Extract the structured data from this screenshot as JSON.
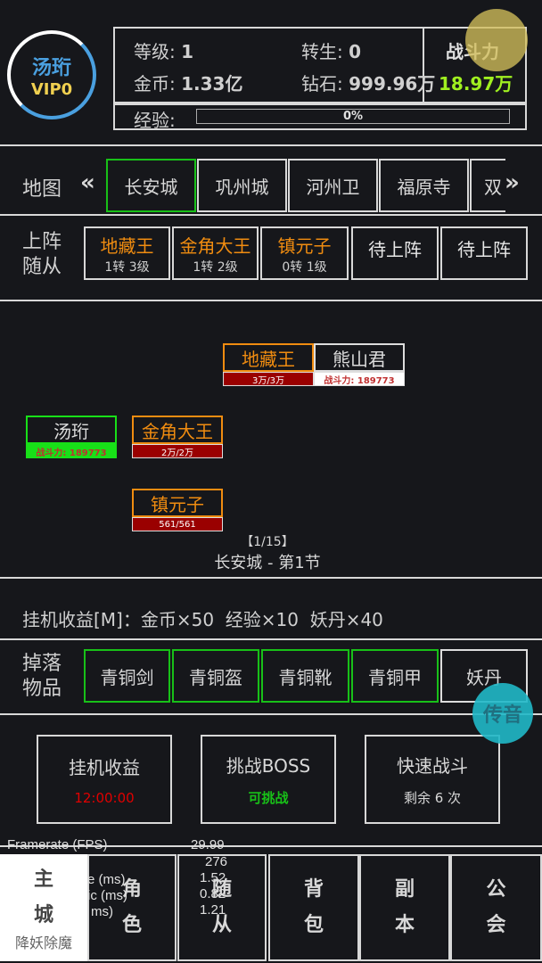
{
  "player": {
    "name": "汤珩",
    "vip": "VIP0"
  },
  "stats": {
    "level_label": "等级:",
    "level": "1",
    "rebirth_label": "转生:",
    "rebirth": "0",
    "gold_label": "金币:",
    "gold": "1.33亿",
    "diamond_label": "钻石:",
    "diamond": "999.96万",
    "power_label": "战斗力",
    "power": "18.97万",
    "exp_label": "经验:",
    "exp_text": "0%",
    "exp_progress": 0
  },
  "map": {
    "label": "地图",
    "prev": "«",
    "next": "»",
    "tabs": [
      "长安城",
      "巩州城",
      "河州卫",
      "福原寺",
      "双"
    ],
    "selected": "长安城"
  },
  "followers": {
    "label_line1": "上阵",
    "label_line2": "随从",
    "slots": [
      {
        "name": "地藏王",
        "info": "1转 3级"
      },
      {
        "name": "金角大王",
        "info": "1转 2级"
      },
      {
        "name": "镇元子",
        "info": "0转 1级"
      },
      {
        "name": "待上阵",
        "info": ""
      },
      {
        "name": "待上阵",
        "info": ""
      }
    ]
  },
  "battle": {
    "enemy": {
      "name": "熊山君",
      "power": "战斗力: 189773"
    },
    "ally_top": {
      "name": "地藏王",
      "hp": "3万/3万"
    },
    "player": {
      "name": "汤珩",
      "power": "战斗力: 189773"
    },
    "ally_mid": {
      "name": "金角大王",
      "hp": "2万/2万"
    },
    "ally_bot": {
      "name": "镇元子",
      "hp": "561/561"
    },
    "stage_count": "【1/15】",
    "stage_name": "长安城 - 第1节"
  },
  "idle": {
    "text": "挂机收益[M]：金币×50  经验×10  妖丹×40"
  },
  "drops": {
    "label_line1": "掉落",
    "label_line2": "物品",
    "items": [
      "青铜剑",
      "青铜盔",
      "青铜靴",
      "青铜甲",
      "妖丹"
    ]
  },
  "chat": {
    "label": "传音"
  },
  "actions": [
    {
      "title": "挂机收益",
      "sub": "12:00:00"
    },
    {
      "title": "挑战BOSS",
      "sub": "可挑战"
    },
    {
      "title": "快速战斗",
      "sub": "剩余 6 次"
    }
  ],
  "nav": {
    "main_line1": "主",
    "main_line2": "城",
    "main_sub": "降妖除魔",
    "items": [
      [
        "角",
        "色"
      ],
      [
        "随",
        "从"
      ],
      [
        "背",
        "包"
      ],
      [
        "副",
        "本"
      ],
      [
        "公",
        "会"
      ]
    ]
  },
  "fps": {
    "label": "Framerate (FPS)",
    "value": "29.99",
    "rows": [
      {
        "label": "",
        "value": "276"
      },
      {
        "label": "e (ms)",
        "value": "1.52"
      },
      {
        "label": "ic (ms)",
        "value": "0.82"
      },
      {
        "label": "ms)",
        "value": "1.21"
      }
    ]
  },
  "colors": {
    "accent_green": "#18c018",
    "orange": "#f08c10",
    "hp_red": "#9a0000",
    "name_blue": "#4aa0e0",
    "vip_yellow": "#f0d050",
    "power_green": "#a0f020",
    "chat_cyan": "#20b8c8"
  }
}
